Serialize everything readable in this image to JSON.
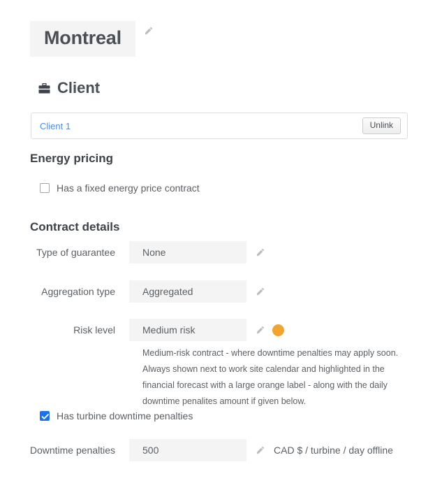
{
  "page": {
    "title": "Montreal",
    "title_edit_icon": "pencil-icon"
  },
  "client_section": {
    "icon": "briefcase-icon",
    "heading": "Client",
    "client_name": "Client 1",
    "unlink_label": "Unlink"
  },
  "energy_pricing": {
    "heading": "Energy pricing",
    "fixed_price_checkbox": {
      "label": "Has a fixed energy price contract",
      "checked": false
    }
  },
  "contract_details": {
    "heading": "Contract details",
    "fields": [
      {
        "label": "Type of guarantee",
        "value": "None",
        "edit_icon": "pencil-icon"
      },
      {
        "label": "Aggregation type",
        "value": "Aggregated",
        "edit_icon": "pencil-icon"
      },
      {
        "label": "Risk level",
        "value": "Medium risk",
        "edit_icon": "pencil-icon",
        "indicator_color": "#f2a431"
      }
    ],
    "risk_description": "Medium-risk contract - where downtime penalties may apply soon. Always shown next to work site calendar and highlighted in the financial forecast with a large orange label - along with the daily downtime penalites amount if given below.",
    "turbine_penalties_checkbox": {
      "label": "Has turbine downtime penalties",
      "checked": true
    },
    "downtime_penalties": {
      "label": "Downtime penalties",
      "value": "500",
      "edit_icon": "pencil-icon",
      "suffix": "CAD $ / turbine / day offline"
    }
  },
  "colors": {
    "accent_link": "#4a90d9",
    "checkbox_checked": "#1a73e8",
    "risk_medium": "#f2a431",
    "field_background": "#f4f4f4"
  }
}
